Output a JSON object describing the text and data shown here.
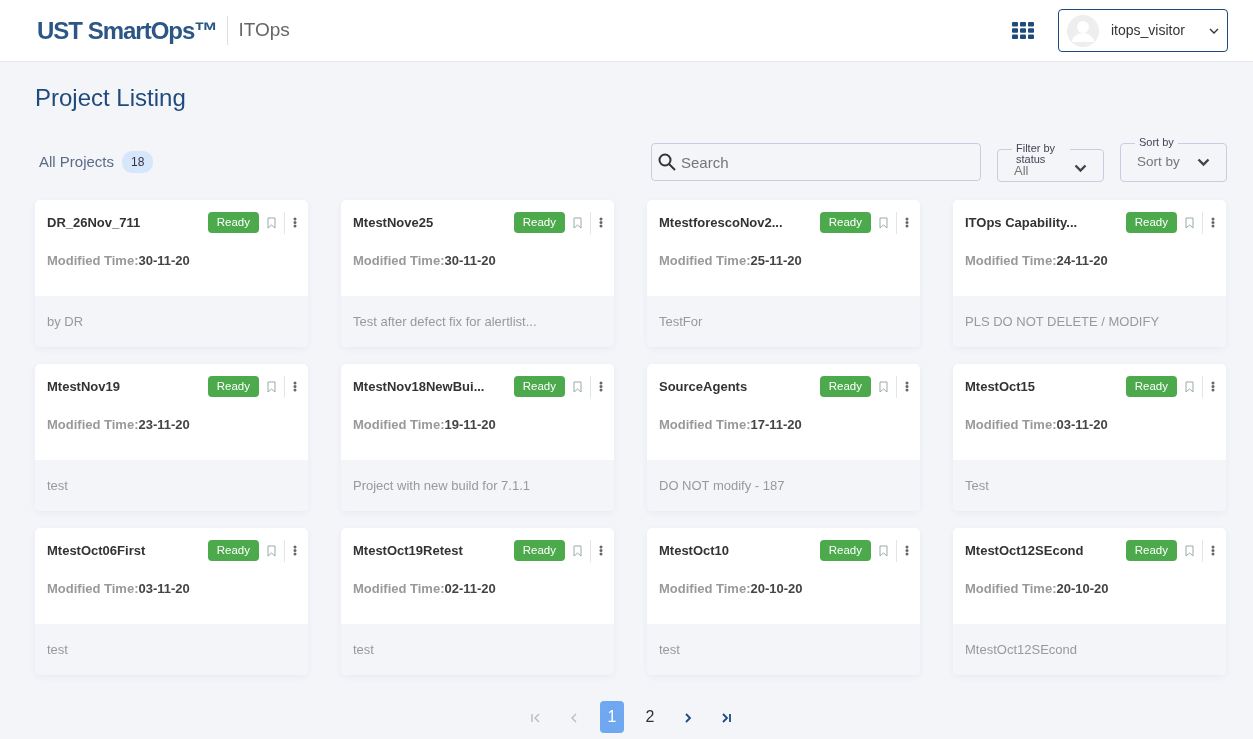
{
  "header": {
    "brand": "UST SmartOps™",
    "product": "ITOps",
    "user": {
      "name": "itops_visitor"
    }
  },
  "page_title": "Project Listing",
  "all_projects": {
    "label": "All Projects",
    "count": "18"
  },
  "search": {
    "placeholder": "Search"
  },
  "filter": {
    "label": "Filter by status",
    "value": "All"
  },
  "sort": {
    "label": "Sort by",
    "value": "Sort by"
  },
  "projects": [
    {
      "name": "DR_26Nov_711",
      "status": "Ready",
      "modified_label": "Modified Time:",
      "modified": "30-11-20",
      "description": "by DR"
    },
    {
      "name": "MtestNove25",
      "status": "Ready",
      "modified_label": "Modified Time:",
      "modified": "30-11-20",
      "description": "Test after defect fix for alertlist..."
    },
    {
      "name": "MtestforescoNov2...",
      "status": "Ready",
      "modified_label": "Modified Time:",
      "modified": "25-11-20",
      "description": "TestFor"
    },
    {
      "name": "ITOps Capability...",
      "status": "Ready",
      "modified_label": "Modified Time:",
      "modified": "24-11-20",
      "description": "PLS DO NOT DELETE / MODIFY"
    },
    {
      "name": "MtestNov19",
      "status": "Ready",
      "modified_label": "Modified Time:",
      "modified": "23-11-20",
      "description": "test"
    },
    {
      "name": "MtestNov18NewBui...",
      "status": "Ready",
      "modified_label": "Modified Time:",
      "modified": "19-11-20",
      "description": "Project with new build for 7.1.1"
    },
    {
      "name": "SourceAgents",
      "status": "Ready",
      "modified_label": "Modified Time:",
      "modified": "17-11-20",
      "description": "DO NOT modify - 187"
    },
    {
      "name": "MtestOct15",
      "status": "Ready",
      "modified_label": "Modified Time:",
      "modified": "03-11-20",
      "description": "Test"
    },
    {
      "name": "MtestOct06First",
      "status": "Ready",
      "modified_label": "Modified Time:",
      "modified": "03-11-20",
      "description": "test"
    },
    {
      "name": "MtestOct19Retest",
      "status": "Ready",
      "modified_label": "Modified Time:",
      "modified": "02-11-20",
      "description": "test"
    },
    {
      "name": "MtestOct10",
      "status": "Ready",
      "modified_label": "Modified Time:",
      "modified": "20-10-20",
      "description": "test"
    },
    {
      "name": "MtestOct12SEcond",
      "status": "Ready",
      "modified_label": "Modified Time:",
      "modified": "20-10-20",
      "description": "MtestOct12SEcond"
    }
  ],
  "pagination": {
    "first": {
      "disabled": true
    },
    "prev": {
      "disabled": true
    },
    "pages": [
      {
        "label": "1",
        "selected": true
      },
      {
        "label": "2",
        "selected": false
      }
    ],
    "next": {
      "disabled": false
    },
    "last": {
      "disabled": false
    }
  }
}
